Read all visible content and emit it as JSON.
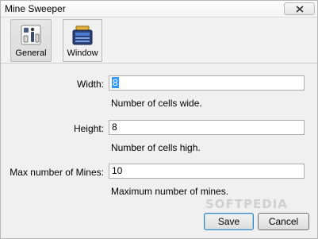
{
  "window": {
    "title": "Mine Sweeper",
    "close_icon": "close-x-icon"
  },
  "toolbar": {
    "items": [
      {
        "label": "General",
        "icon": "settings-switches-icon",
        "selected": true
      },
      {
        "label": "Window",
        "icon": "window-icon",
        "selected": false
      }
    ]
  },
  "form": {
    "width": {
      "label": "Width:",
      "value": "8",
      "hint": "Number of cells wide."
    },
    "height": {
      "label": "Height:",
      "value": "8",
      "hint": "Number of cells high."
    },
    "mines": {
      "label": "Max number of Mines:",
      "value": "10",
      "hint": "Maximum number of mines."
    }
  },
  "buttons": {
    "save": "Save",
    "cancel": "Cancel"
  },
  "watermark": "SOFTPEDIA"
}
